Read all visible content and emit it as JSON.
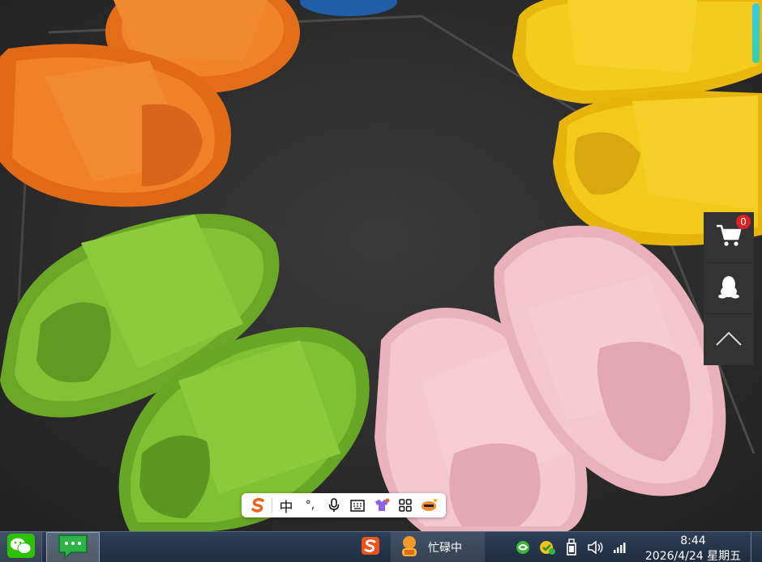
{
  "side_toolbar": {
    "cart_count": "0",
    "icons": [
      "shopping-cart-icon",
      "qq-penguin-icon",
      "back-to-top-icon"
    ]
  },
  "ime_bar": {
    "brand_icon": "sogou-s-icon",
    "mode_label": "中",
    "punct_label": "°,",
    "icons": [
      "microphone-icon",
      "keyboard-icon",
      "skin-icon",
      "toolbox-icon",
      "mascot-icon"
    ]
  },
  "taskbar": {
    "busy_label": "忙碌中",
    "time": "8:44",
    "date": "2026/4/24 星期五",
    "tray_icons": [
      "360-icon",
      "security-icon",
      "usb-device-icon",
      "volume-icon",
      "network-icon"
    ]
  },
  "colors": {
    "orange_slipper": "#ef7a22",
    "yellow_slipper": "#f1c61a",
    "green_slipper": "#78b82c",
    "pink_slipper": "#f2c3cc",
    "mat": "#2c2c2c",
    "taskbar": "#263850"
  }
}
